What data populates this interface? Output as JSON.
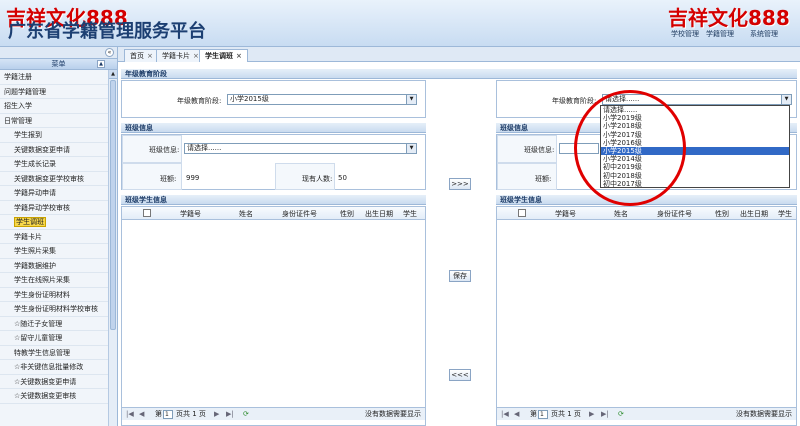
{
  "header": {
    "watermark_left": "吉祥文化888",
    "watermark_right": "吉祥文化888",
    "title": "广东省学籍管理服务平台",
    "nav": [
      "学校管理",
      "学籍管理",
      "系统管理"
    ]
  },
  "sidebar": {
    "header": "菜单",
    "items": [
      {
        "label": "学籍注册",
        "level": 1
      },
      {
        "label": "问题学籍管理",
        "level": 1
      },
      {
        "label": "招生入学",
        "level": 1
      },
      {
        "label": "日常管理",
        "level": 1
      },
      {
        "label": "学生报到",
        "level": 2
      },
      {
        "label": "关键数据变更申请",
        "level": 2
      },
      {
        "label": "学生成长记录",
        "level": 2
      },
      {
        "label": "关键数据变更学校审核",
        "level": 2
      },
      {
        "label": "学籍异动申请",
        "level": 2
      },
      {
        "label": "学籍异动学校审核",
        "level": 2
      },
      {
        "label": "学生调班",
        "level": 2,
        "selected": true
      },
      {
        "label": "学籍卡片",
        "level": 2
      },
      {
        "label": "学生照片采集",
        "level": 2
      },
      {
        "label": "学籍数据维护",
        "level": 2
      },
      {
        "label": "学生在线照片采集",
        "level": 2
      },
      {
        "label": "学生身份证明材料",
        "level": 2
      },
      {
        "label": "学生身份证明材料学校审核",
        "level": 2
      },
      {
        "label": "☆随迁子女管理",
        "level": 2
      },
      {
        "label": "☆留守儿童管理",
        "level": 2
      },
      {
        "label": "特教学生信息管理",
        "level": 2
      },
      {
        "label": "☆非关键信息批量修改",
        "level": 2
      },
      {
        "label": "☆关键数据变更申请",
        "level": 2
      },
      {
        "label": "☆关键数据变更审核",
        "level": 2
      }
    ]
  },
  "tabs": [
    {
      "label": "首页"
    },
    {
      "label": "学籍卡片"
    },
    {
      "label": "学生调班",
      "active": true
    }
  ],
  "grade_section": {
    "title": "年级教育阶段",
    "label": "年级教育阶段:",
    "left_value": "小学2015级",
    "right_value": "请选择......"
  },
  "class_section": {
    "title": "班级信息",
    "class_label": "班级信息:",
    "left_class_value": "请选择......",
    "right_class_value": "",
    "class_no_label": "班额:",
    "class_no_value": "999",
    "count_label": "现有人数:",
    "count_value": "50",
    "right_class_no_label": "班额:"
  },
  "student_section": {
    "title": "班级学生信息",
    "columns": [
      "学籍号",
      "姓名",
      "身份证件号",
      "性别",
      "出生日期",
      "学生"
    ]
  },
  "buttons": {
    "move_right": ">>>",
    "save": "保存",
    "move_left": "<<<"
  },
  "pager": {
    "page_prefix": "第",
    "page_value": "1",
    "page_suffix": "页共 1 页",
    "no_data": "没有数据需要显示"
  },
  "dropdown_options": [
    "请选择......",
    "小学2019级",
    "小学2018级",
    "小学2017级",
    "小学2016级",
    "小学2015级",
    "小学2014级",
    "初中2019级",
    "初中2018级",
    "初中2017级"
  ],
  "dropdown_highlight": "小学2015级",
  "colors": {
    "annotation": "#e00000",
    "highlight": "#3169c6",
    "watermark": "#d40000"
  }
}
